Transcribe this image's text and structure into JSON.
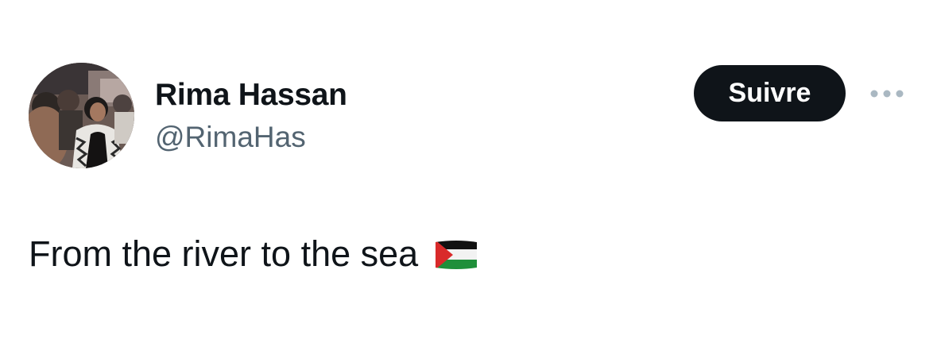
{
  "tweet": {
    "author": {
      "display_name": "Rima Hassan",
      "handle": "@RimaHas",
      "avatar_icon": "profile-photo"
    },
    "follow_label": "Suivre",
    "more_icon": "more-options-icon",
    "text": "From the river to the sea",
    "emoji": "palestine-flag-emoji"
  },
  "colors": {
    "text_primary": "#0f1419",
    "text_secondary": "#536471",
    "button_bg": "#0f1419",
    "button_text": "#ffffff",
    "more_dots": "#aab8c2",
    "flag_black": "#111111",
    "flag_white": "#f2f2f2",
    "flag_green": "#1f8f3a",
    "flag_red": "#d92a2a"
  }
}
